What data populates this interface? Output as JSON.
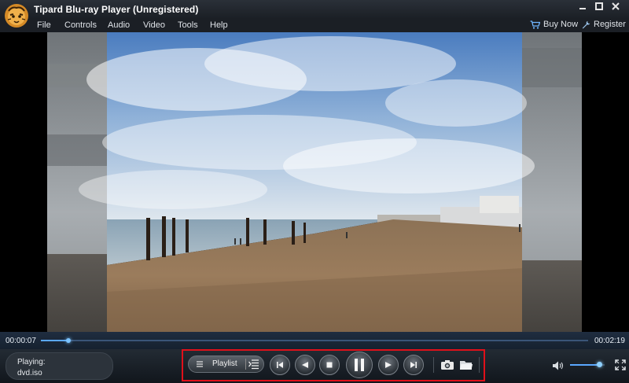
{
  "window": {
    "title": "Tipard Blu-ray Player (Unregistered)",
    "icons": {
      "logo": "tipard-tiger-logo",
      "minimize": "minimize-icon",
      "maximize": "maximize-icon",
      "close": "close-icon"
    }
  },
  "menubar": {
    "items": [
      {
        "label": "File"
      },
      {
        "label": "Controls"
      },
      {
        "label": "Audio"
      },
      {
        "label": "Video"
      },
      {
        "label": "Tools"
      },
      {
        "label": "Help"
      }
    ],
    "buy_now": {
      "label": "Buy Now",
      "icon": "cart-icon"
    },
    "register": {
      "label": "Register",
      "icon": "wrench-icon"
    }
  },
  "playback": {
    "elapsed": "00:00:07",
    "total": "00:02:19",
    "progress": 0.05
  },
  "status": {
    "label": "Playing:",
    "file": "dvd.iso"
  },
  "controls": {
    "playlist_label": "Playlist",
    "icons": [
      "menu-icon",
      "playlist-toggle-icon",
      "previous-icon",
      "rewind-icon",
      "stop-icon",
      "pause-icon",
      "forward-icon",
      "next-icon",
      "camera-icon",
      "folder-icon",
      "volume-icon",
      "fullscreen-icon"
    ],
    "highlight_color": "#e0101a"
  },
  "volume": {
    "level": 0.85
  },
  "colors": {
    "accent": "#5aa8ff",
    "titlebar": "#1b1f25"
  }
}
